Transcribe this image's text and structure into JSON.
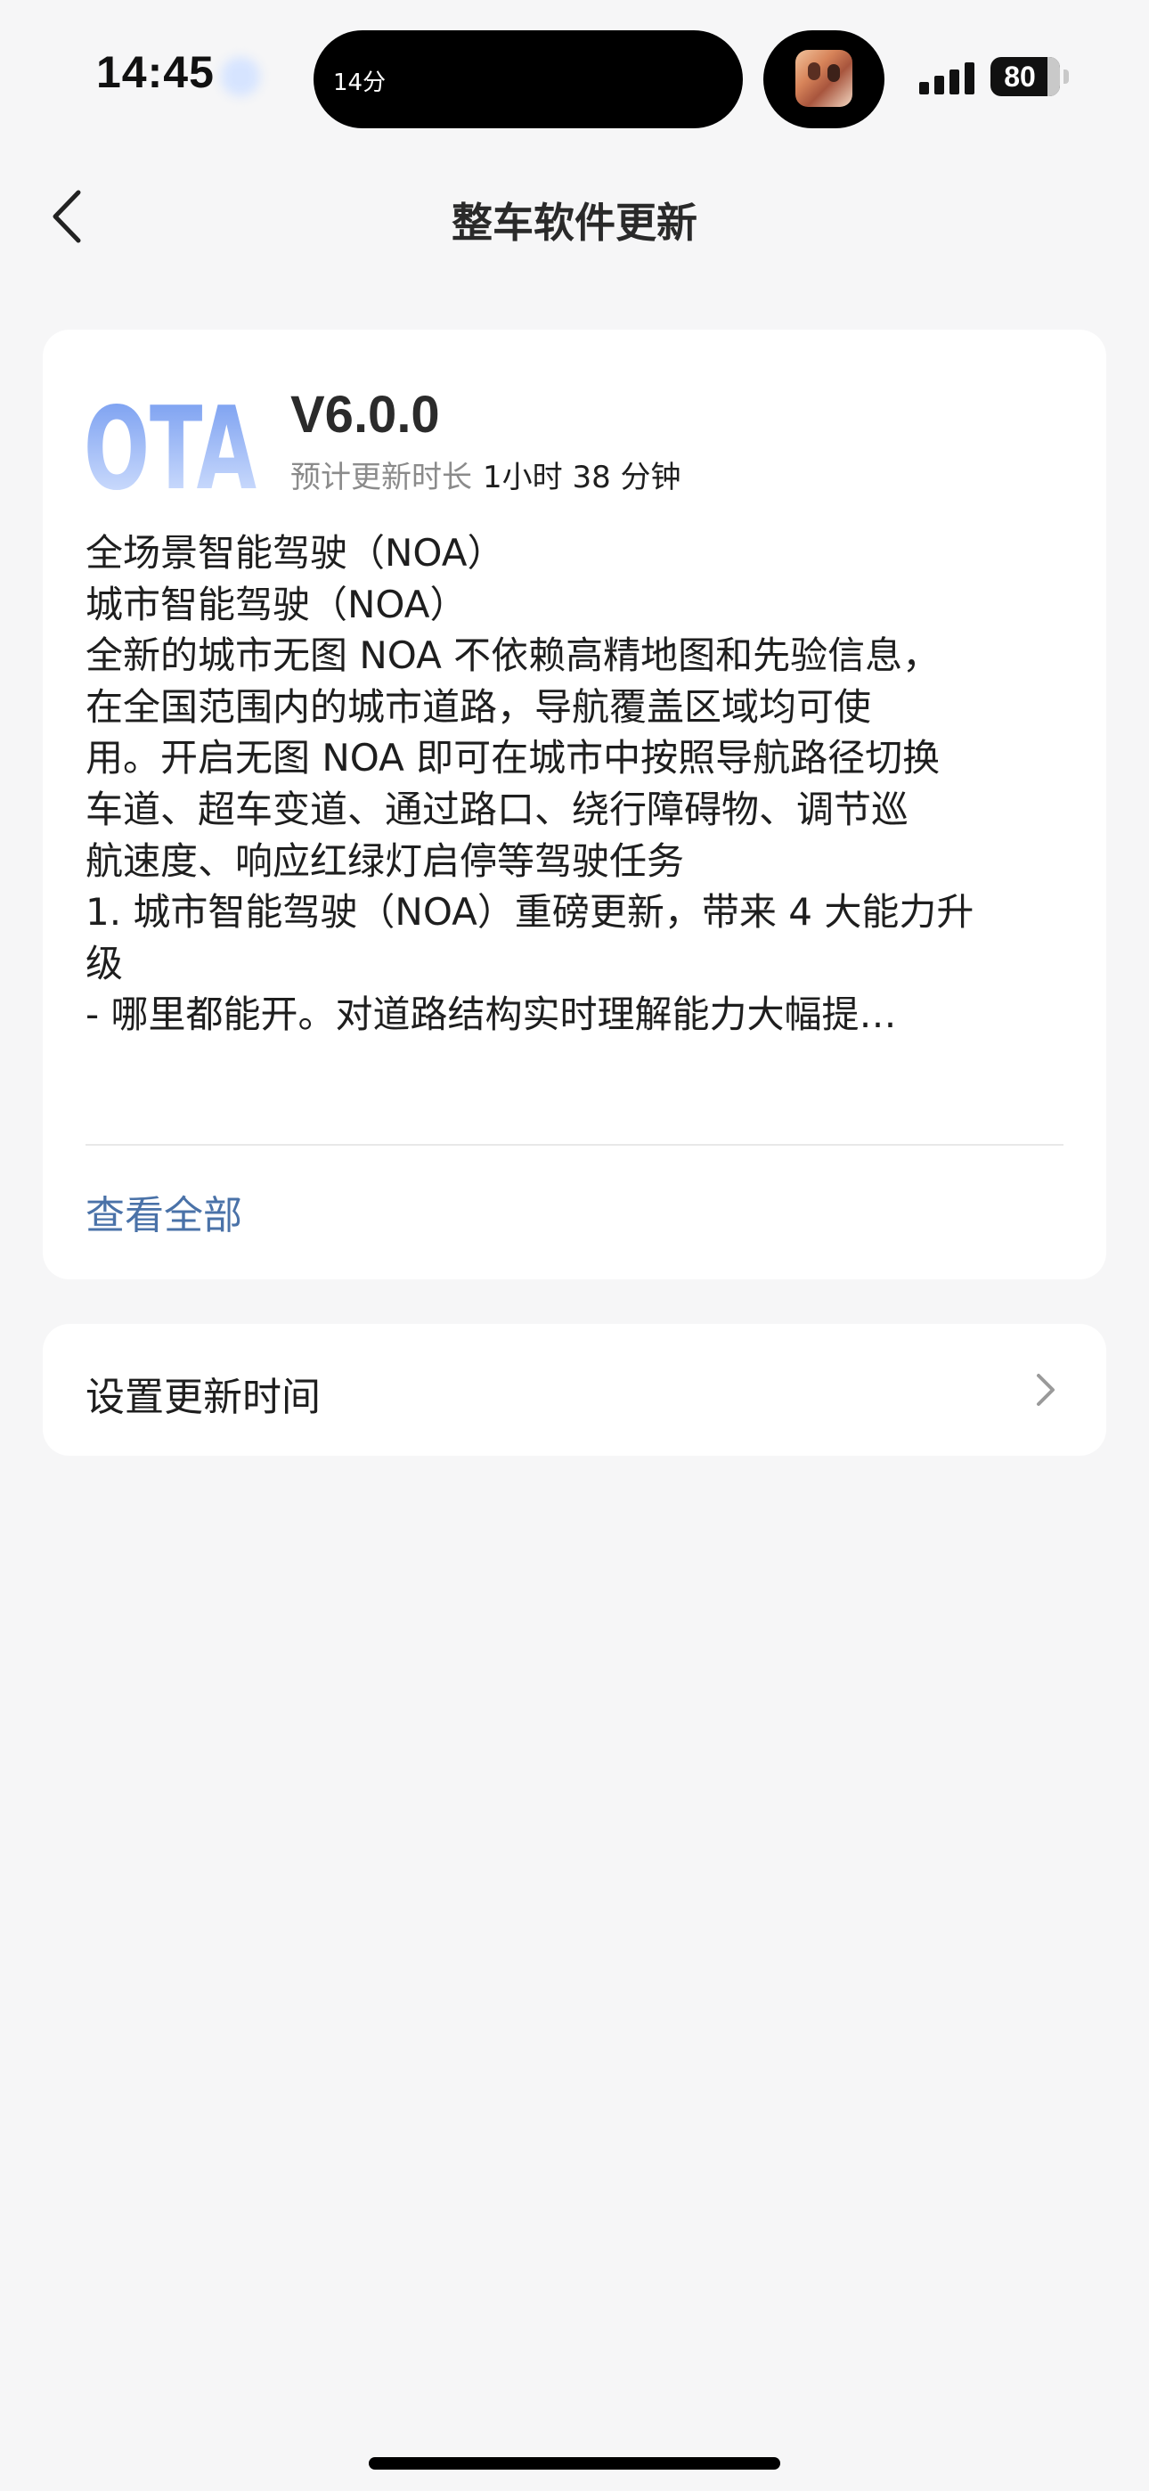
{
  "status_bar": {
    "time": "14:45",
    "live_activity_text": "14分",
    "battery_percent": "80",
    "signal_bars": 4
  },
  "nav": {
    "title": "整车软件更新"
  },
  "update": {
    "logo_text": "OTA",
    "version": "V6.0.0",
    "duration_label": "预计更新时长",
    "duration_value": "1小时 38 分钟",
    "notes": [
      "全场景智能驾驶（NOA）",
      "城市智能驾驶（NOA）",
      "全新的城市无图 NOA 不依赖高精地图和先验信息，",
      "在全国范围内的城市道路，导航覆盖区域均可使",
      "用。开启无图 NOA 即可在城市中按照导航路径切换",
      "车道、超车变道、通过路口、绕行障碍物、调节巡",
      "航速度、响应红绿灯启停等驾驶任务",
      "1. 城市智能驾驶（NOA）重磅更新，带来 4 大能力升",
      "级",
      "- 哪里都能开。对道路结构实时理解能力大幅提…"
    ],
    "view_all_label": "查看全部"
  },
  "schedule": {
    "label": "设置更新时间"
  },
  "colors": {
    "background": "#f6f6f7",
    "card": "#ffffff",
    "link": "#4a72a8",
    "logo_gradient_top": "#6f97ef",
    "logo_gradient_bottom": "#dde8ff"
  }
}
